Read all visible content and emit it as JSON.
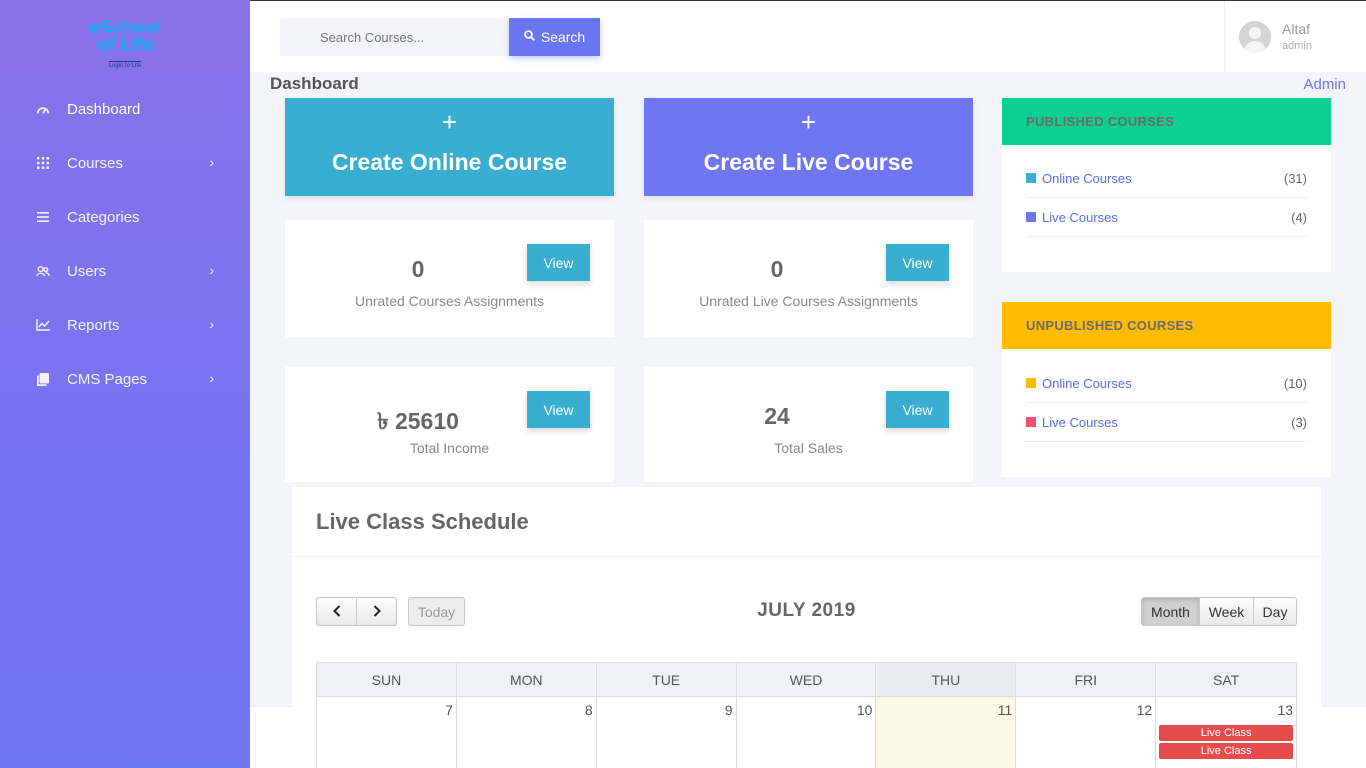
{
  "logo": {
    "line1": "eSchool",
    "line2": "of Life",
    "tagline": "Login to Life"
  },
  "sidebar": {
    "items": [
      {
        "label": "Dashboard",
        "icon": "speedometer-icon"
      },
      {
        "label": "Courses",
        "icon": "grid-icon"
      },
      {
        "label": "Categories",
        "icon": "list-icon"
      },
      {
        "label": "Users",
        "icon": "users-icon"
      },
      {
        "label": "Reports",
        "icon": "chart-icon"
      },
      {
        "label": "CMS Pages",
        "icon": "pages-icon"
      }
    ]
  },
  "topbar": {
    "search_placeholder": "Search Courses...",
    "search_button": "Search",
    "user_name": "Altaf",
    "user_role": "admin"
  },
  "breadcrumb": {
    "title": "Dashboard",
    "role": "Admin"
  },
  "create": {
    "plus": "+",
    "online": "Create Online Course",
    "live": "Create Live Course"
  },
  "stats": [
    {
      "value": "0",
      "label": "Unrated Courses Assignments",
      "button": "View"
    },
    {
      "value": "0",
      "label": "Unrated Live Courses Assignments",
      "button": "View"
    },
    {
      "value": "৳ 25610",
      "label": "Total Income",
      "button": "View"
    },
    {
      "value": "24",
      "label": "Total Sales",
      "button": "View"
    }
  ],
  "published": {
    "title": "PUBLISHED COURSES",
    "color": "#0cd08f",
    "rows": [
      {
        "label": "Online Courses",
        "count": "(31)",
        "color": "#39aed1"
      },
      {
        "label": "Live Courses",
        "count": "(4)",
        "color": "#6f76f2"
      }
    ]
  },
  "unpublished": {
    "title": "UNPUBLISHED COURSES",
    "color": "#ffbb00",
    "rows": [
      {
        "label": "Online Courses",
        "count": "(10)",
        "color": "#ffbb00"
      },
      {
        "label": "Live Courses",
        "count": "(3)",
        "color": "#f0506e"
      }
    ]
  },
  "schedule": {
    "title": "Live Class Schedule",
    "month_title": "JULY 2019",
    "today_button": "Today",
    "prev_icon": "chevron-left-icon",
    "next_icon": "chevron-right-icon",
    "views": [
      "Month",
      "Week",
      "Day"
    ],
    "weekdays": [
      "SUN",
      "MON",
      "TUE",
      "WED",
      "THU",
      "FRI",
      "SAT"
    ],
    "days": [
      "7",
      "8",
      "9",
      "10",
      "11",
      "12",
      "13"
    ],
    "events": [
      "Live Class",
      "Live Class"
    ]
  }
}
